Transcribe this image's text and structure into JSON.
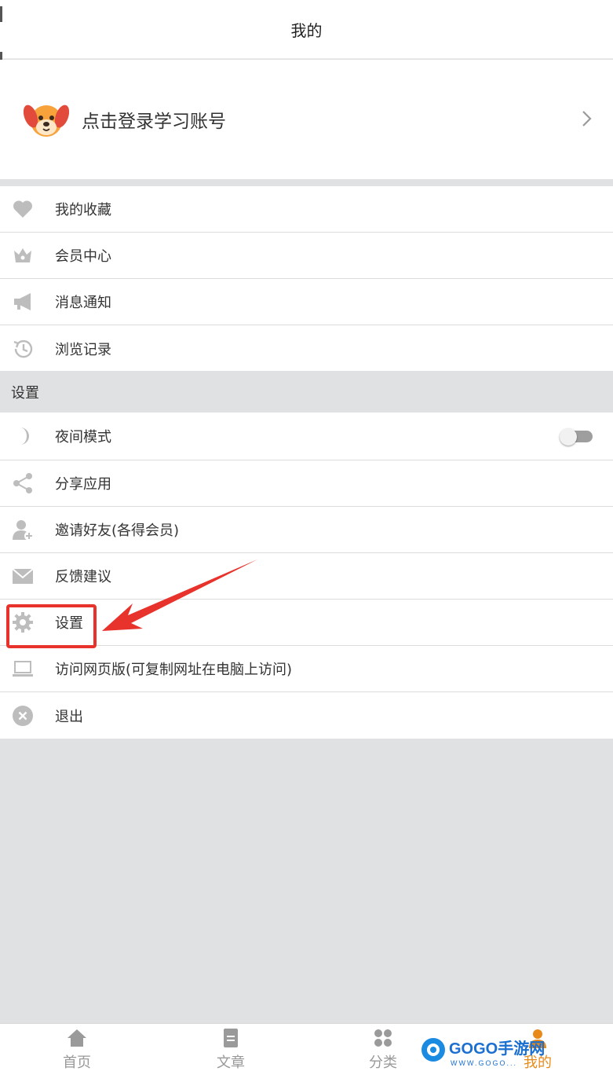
{
  "header": {
    "title": "我的"
  },
  "login": {
    "label": "点击登录学习账号"
  },
  "menu_group_1": [
    {
      "label": "我的收藏",
      "icon": "heart-icon"
    },
    {
      "label": "会员中心",
      "icon": "crown-icon"
    },
    {
      "label": "消息通知",
      "icon": "megaphone-icon"
    },
    {
      "label": "浏览记录",
      "icon": "history-icon"
    }
  ],
  "section_title": "设置",
  "menu_group_2": [
    {
      "label": "夜间模式",
      "icon": "moon-icon",
      "toggle": false
    },
    {
      "label": "分享应用",
      "icon": "share-icon"
    },
    {
      "label": "邀请好友(各得会员)",
      "icon": "add-user-icon"
    },
    {
      "label": "反馈建议",
      "icon": "mail-icon"
    },
    {
      "label": "设置",
      "icon": "gear-icon"
    },
    {
      "label": "访问网页版(可复制网址在电脑上访问)",
      "icon": "laptop-icon"
    },
    {
      "label": "退出",
      "icon": "close-circle-icon"
    }
  ],
  "tabs": [
    {
      "label": "首页",
      "icon": "home-icon",
      "active": false
    },
    {
      "label": "文章",
      "icon": "document-icon",
      "active": false
    },
    {
      "label": "分类",
      "icon": "grid-icon",
      "active": false
    },
    {
      "label": "我的",
      "icon": "user-icon",
      "active": true
    }
  ],
  "watermark": {
    "brand": "GOGO手游网",
    "url": "WWW.GOGO..."
  },
  "colors": {
    "accent": "#e88a1a",
    "highlight": "#e8322c",
    "icon_gray": "#bdbdbd",
    "background": "#e0e1e3"
  }
}
